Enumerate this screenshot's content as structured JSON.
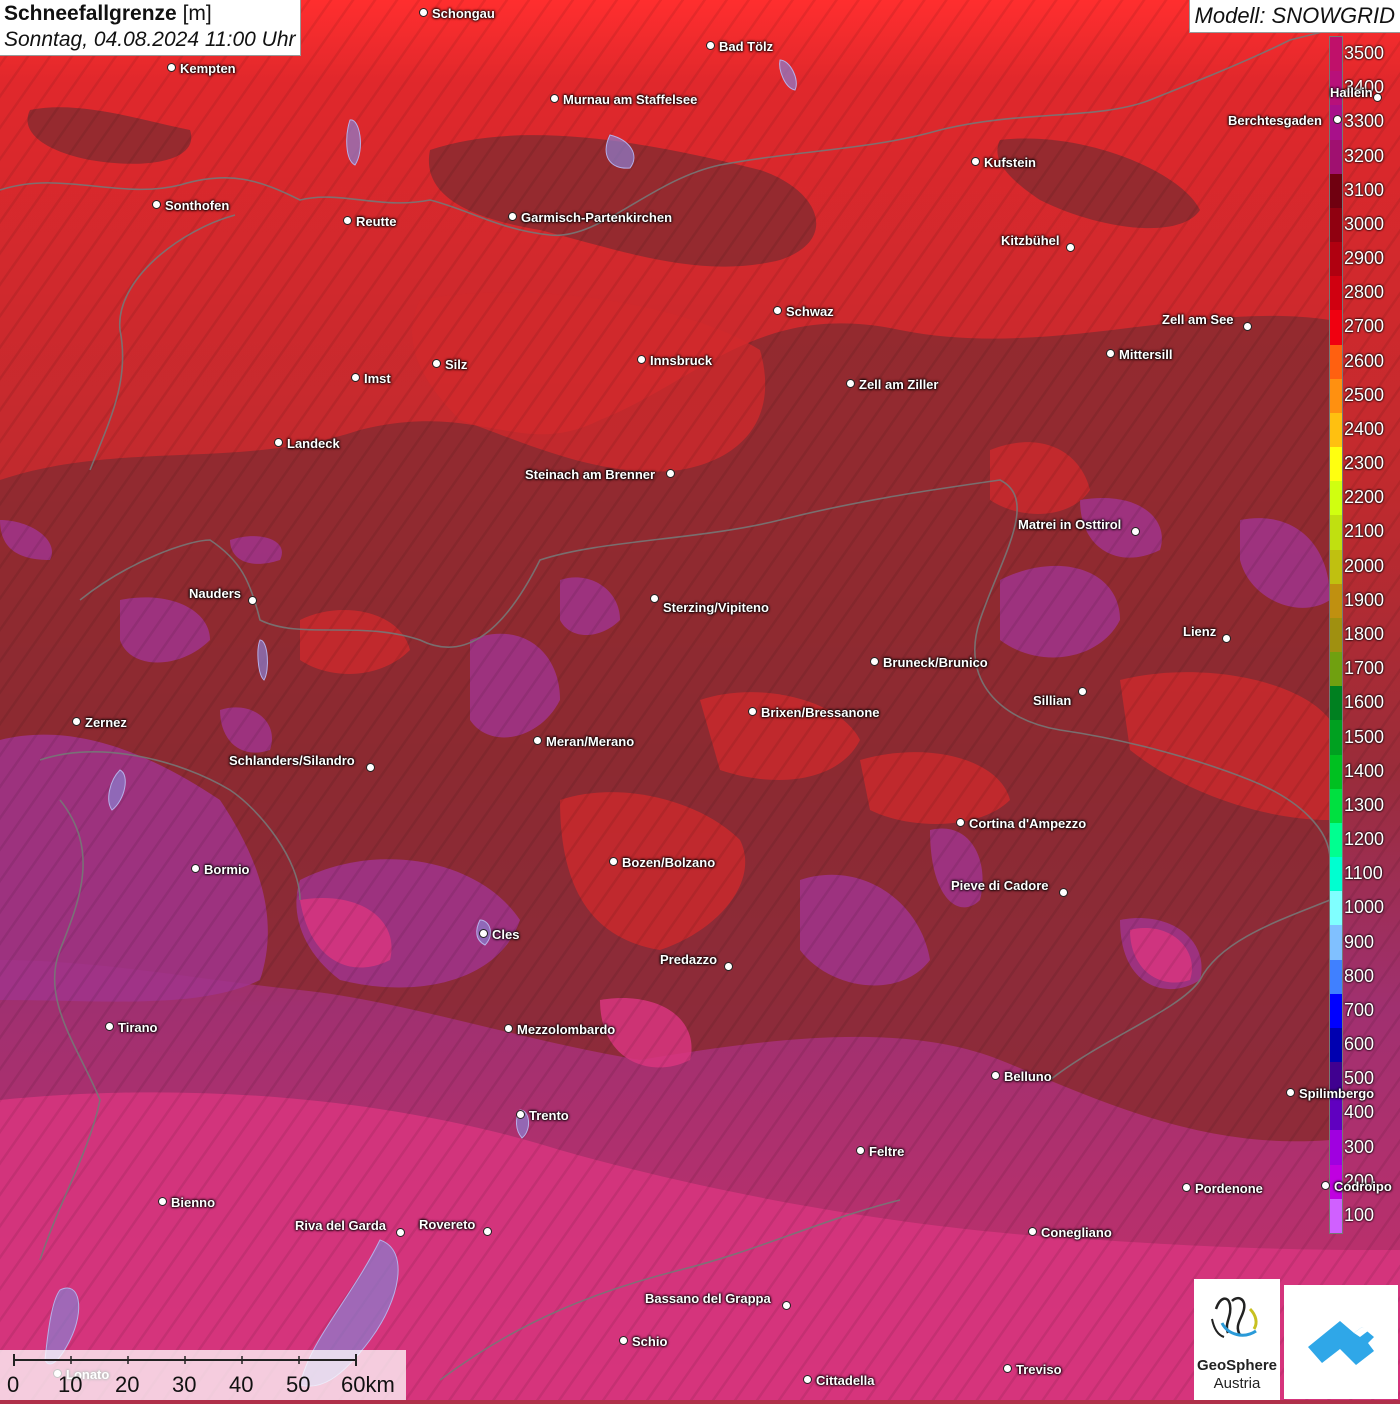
{
  "title": {
    "name": "Schneefallgrenze",
    "unit": "[m]",
    "datetime": "Sonntag, 04.08.2024 11:00 Uhr"
  },
  "model": "Modell: SNOWGRID",
  "legend": {
    "values": [
      "3500",
      "3400",
      "3300",
      "3200",
      "3100",
      "3000",
      "2900",
      "2800",
      "2700",
      "2600",
      "2500",
      "2400",
      "2300",
      "2200",
      "2100",
      "2000",
      "1900",
      "1800",
      "1700",
      "1600",
      "1500",
      "1400",
      "1300",
      "1200",
      "1100",
      "1000",
      "900",
      "800",
      "700",
      "600",
      "500",
      "400",
      "300",
      "200",
      "100"
    ],
    "colors": [
      "#c0106a",
      "#b8107a",
      "#a8108a",
      "#a01070",
      "#700010",
      "#900010",
      "#b00010",
      "#d00010",
      "#f00010",
      "#ff6010",
      "#ff9010",
      "#ffc010",
      "#ffff10",
      "#d0ff10",
      "#c0e010",
      "#c0c010",
      "#c09010",
      "#a09010",
      "#70a010",
      "#008020",
      "#00a020",
      "#00c020",
      "#00e040",
      "#00ff90",
      "#00ffd0",
      "#80ffff",
      "#80c0ff",
      "#4080ff",
      "#0000ff",
      "#0000b0",
      "#400090",
      "#6000c0",
      "#a000e0",
      "#c000e0",
      "#d060ff"
    ]
  },
  "cities": [
    {
      "name": "Schongau"
    },
    {
      "name": "Bad Tölz"
    },
    {
      "name": "Kempten"
    },
    {
      "name": "Murnau am Staffelsee"
    },
    {
      "name": "Berchtesgaden"
    },
    {
      "name": "Hallein"
    },
    {
      "name": "Kufstein"
    },
    {
      "name": "Sonthofen"
    },
    {
      "name": "Reutte"
    },
    {
      "name": "Garmisch-Partenkirchen"
    },
    {
      "name": "Kitzbühel"
    },
    {
      "name": "Schwaz"
    },
    {
      "name": "Zell am See"
    },
    {
      "name": "Mittersill"
    },
    {
      "name": "Innsbruck"
    },
    {
      "name": "Imst"
    },
    {
      "name": "Silz"
    },
    {
      "name": "Zell am Ziller"
    },
    {
      "name": "Landeck"
    },
    {
      "name": "Steinach am Brenner"
    },
    {
      "name": "Matrei in Osttirol"
    },
    {
      "name": "Nauders"
    },
    {
      "name": "Sterzing/Vipiteno"
    },
    {
      "name": "Lienz"
    },
    {
      "name": "Bruneck/Brunico"
    },
    {
      "name": "Sillian"
    },
    {
      "name": "Zernez"
    },
    {
      "name": "Brixen/Bressanone"
    },
    {
      "name": "Meran/Merano"
    },
    {
      "name": "Schlanders/Silandro"
    },
    {
      "name": "Cortina d'Ampezzo"
    },
    {
      "name": "Bormio"
    },
    {
      "name": "Bozen/Bolzano"
    },
    {
      "name": "Pieve di Cadore"
    },
    {
      "name": "Cles"
    },
    {
      "name": "Predazzo"
    },
    {
      "name": "Tirano"
    },
    {
      "name": "Mezzolombardo"
    },
    {
      "name": "Belluno"
    },
    {
      "name": "Spilimbergo"
    },
    {
      "name": "Trento"
    },
    {
      "name": "Feltre"
    },
    {
      "name": "Pordenone"
    },
    {
      "name": "Codroipo"
    },
    {
      "name": "Bienno"
    },
    {
      "name": "Riva del Garda"
    },
    {
      "name": "Rovereto"
    },
    {
      "name": "Conegliano"
    },
    {
      "name": "Bassano del Grappa"
    },
    {
      "name": "Schio"
    },
    {
      "name": "Treviso"
    },
    {
      "name": "Cittadella"
    },
    {
      "name": "Lonato"
    }
  ],
  "scalebar": {
    "labels": [
      "0",
      "10",
      "20",
      "30",
      "40",
      "50",
      "60km"
    ]
  },
  "logos": {
    "geosphere_line1": "GeoSphere",
    "geosphere_line2": "Austria"
  },
  "colors": {
    "high_red": "#c8262c",
    "dark_red": "#8a2a2e",
    "magenta": "#a23a86",
    "pink": "#d8357f"
  }
}
